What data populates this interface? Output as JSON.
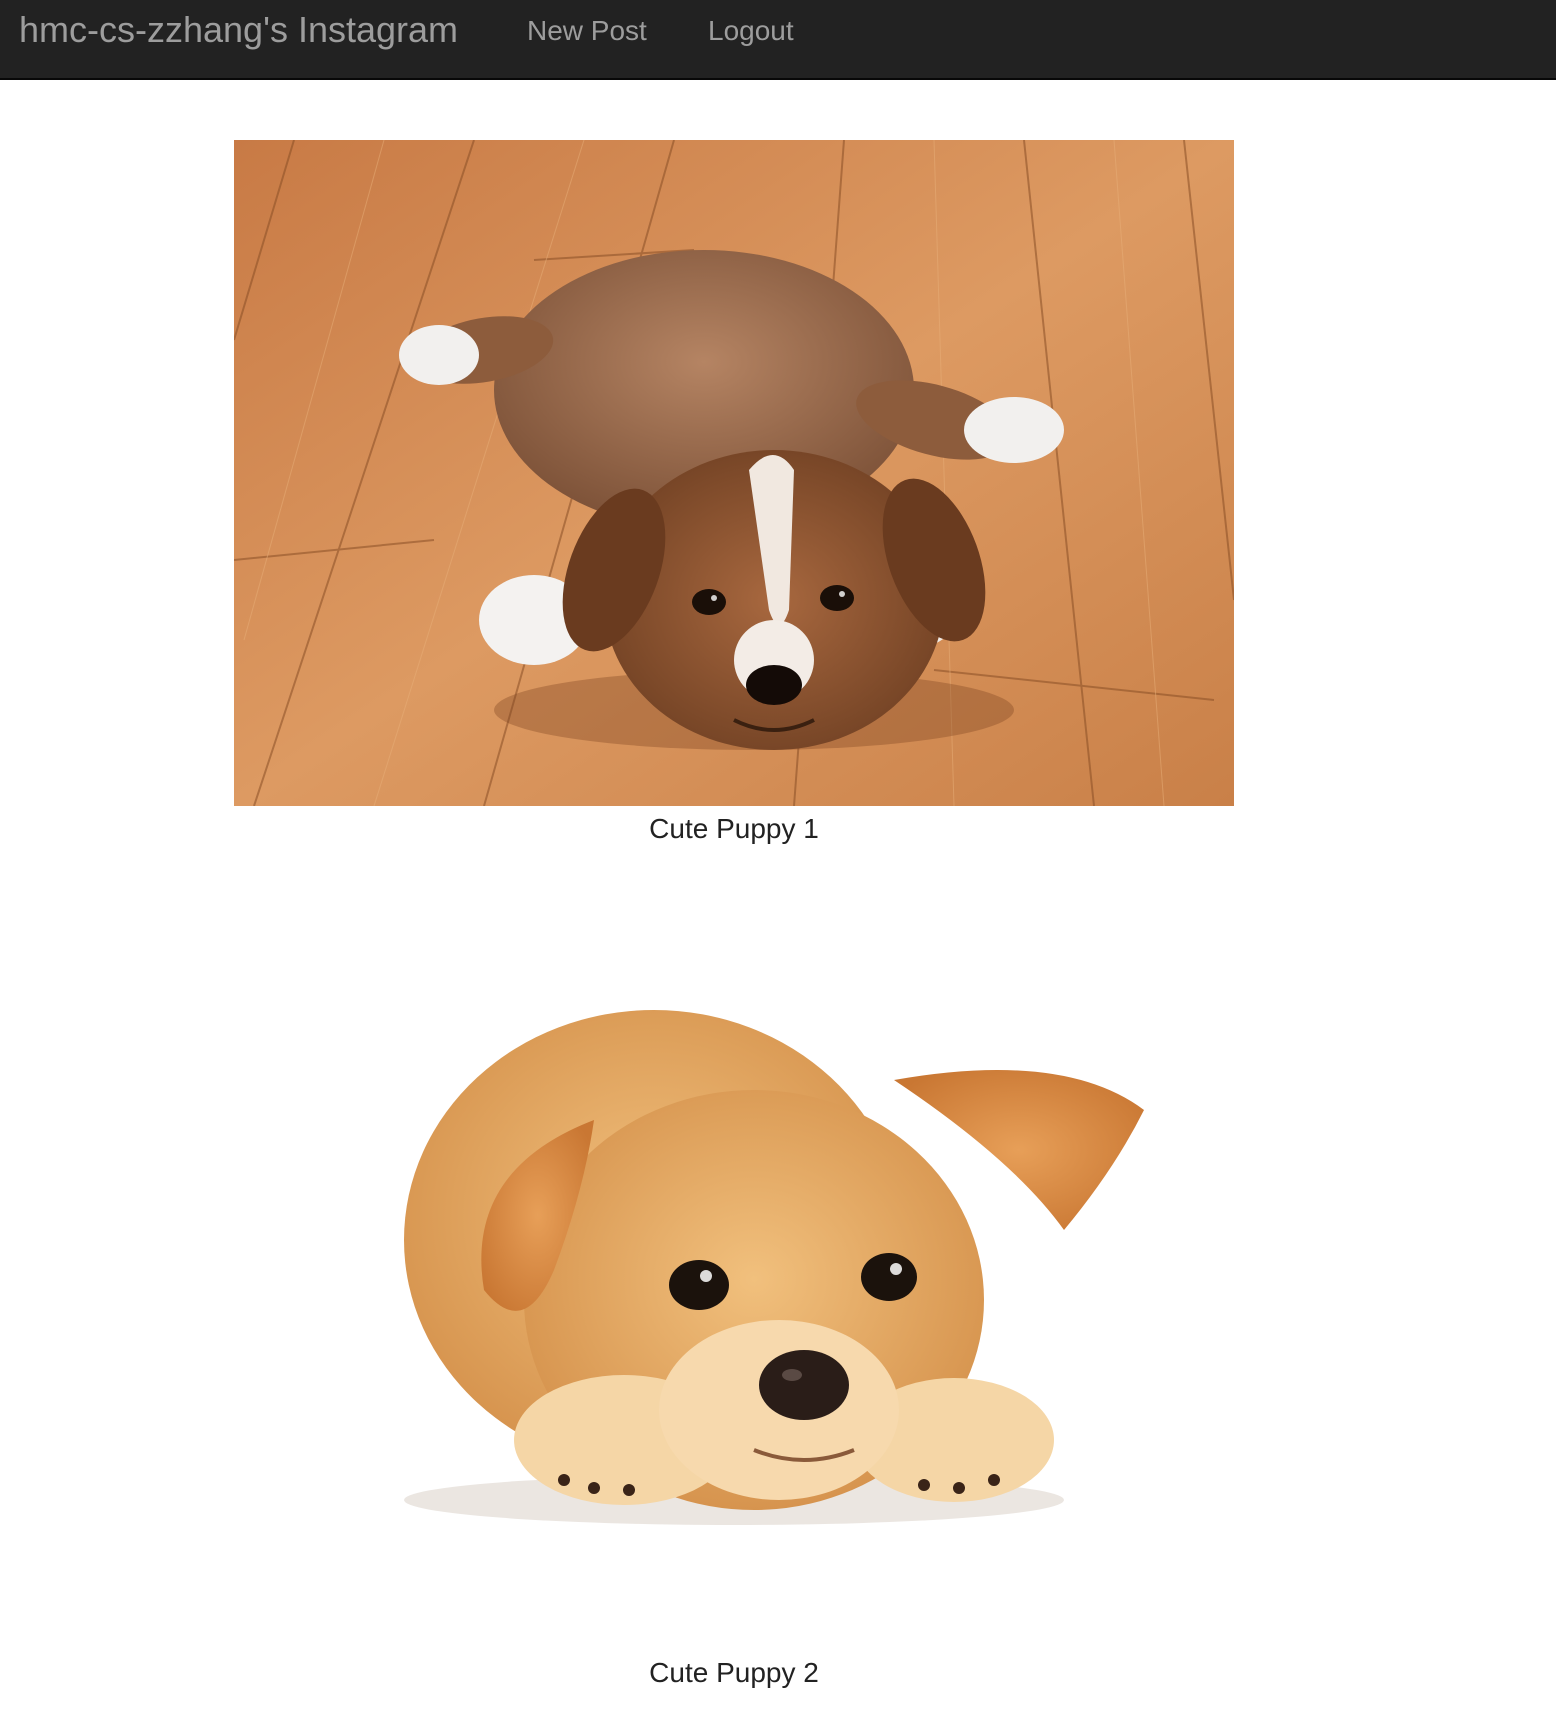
{
  "navbar": {
    "brand": "hmc-cs-zzhang's Instagram",
    "links": [
      {
        "label": "New Post"
      },
      {
        "label": "Logout"
      }
    ],
    "background_color": "#222222",
    "link_color": "#9d9d9d"
  },
  "posts": [
    {
      "caption": "Cute Puppy 1"
    },
    {
      "caption": "Cute Puppy 2"
    }
  ]
}
